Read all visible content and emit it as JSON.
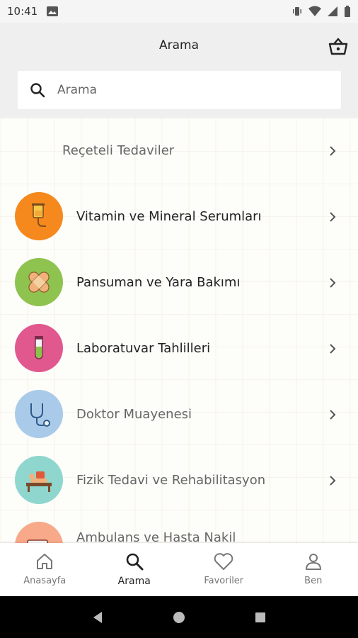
{
  "status_bar": {
    "time": "10:41"
  },
  "header": {
    "title": "Arama"
  },
  "search": {
    "placeholder": "Arama"
  },
  "categories": [
    {
      "label": "Reçeteli Tedaviler",
      "icon": "prescription-icon",
      "color": ""
    },
    {
      "label": "Vitamin ve Mineral Serumları",
      "icon": "iv-drip-icon",
      "color": "#f5891e"
    },
    {
      "label": "Pansuman ve Yara Bakımı",
      "icon": "bandage-icon",
      "color": "#8fc350"
    },
    {
      "label": "Laboratuvar Tahlilleri",
      "icon": "test-tube-icon",
      "color": "#e0588e"
    },
    {
      "label": "Doktor Muayenesi",
      "icon": "stethoscope-icon",
      "color": "#a9cbe9"
    },
    {
      "label": "Fizik Tedavi ve Rehabilitasyon",
      "icon": "physio-icon",
      "color": "#8fd6cf"
    },
    {
      "label": "Ambulans ve Hasta Nakil",
      "icon": "ambulance-icon",
      "color": "#f7a98a"
    }
  ],
  "bottom_nav": [
    {
      "label": "Anasayfa",
      "icon": "home-icon",
      "active": false
    },
    {
      "label": "Arama",
      "icon": "search-icon",
      "active": true
    },
    {
      "label": "Favoriler",
      "icon": "heart-icon",
      "active": false
    },
    {
      "label": "Ben",
      "icon": "person-icon",
      "active": false
    }
  ],
  "colors": {
    "header_bg": "#efefef",
    "nav_active": "#222222",
    "nav_inactive": "#777777"
  }
}
